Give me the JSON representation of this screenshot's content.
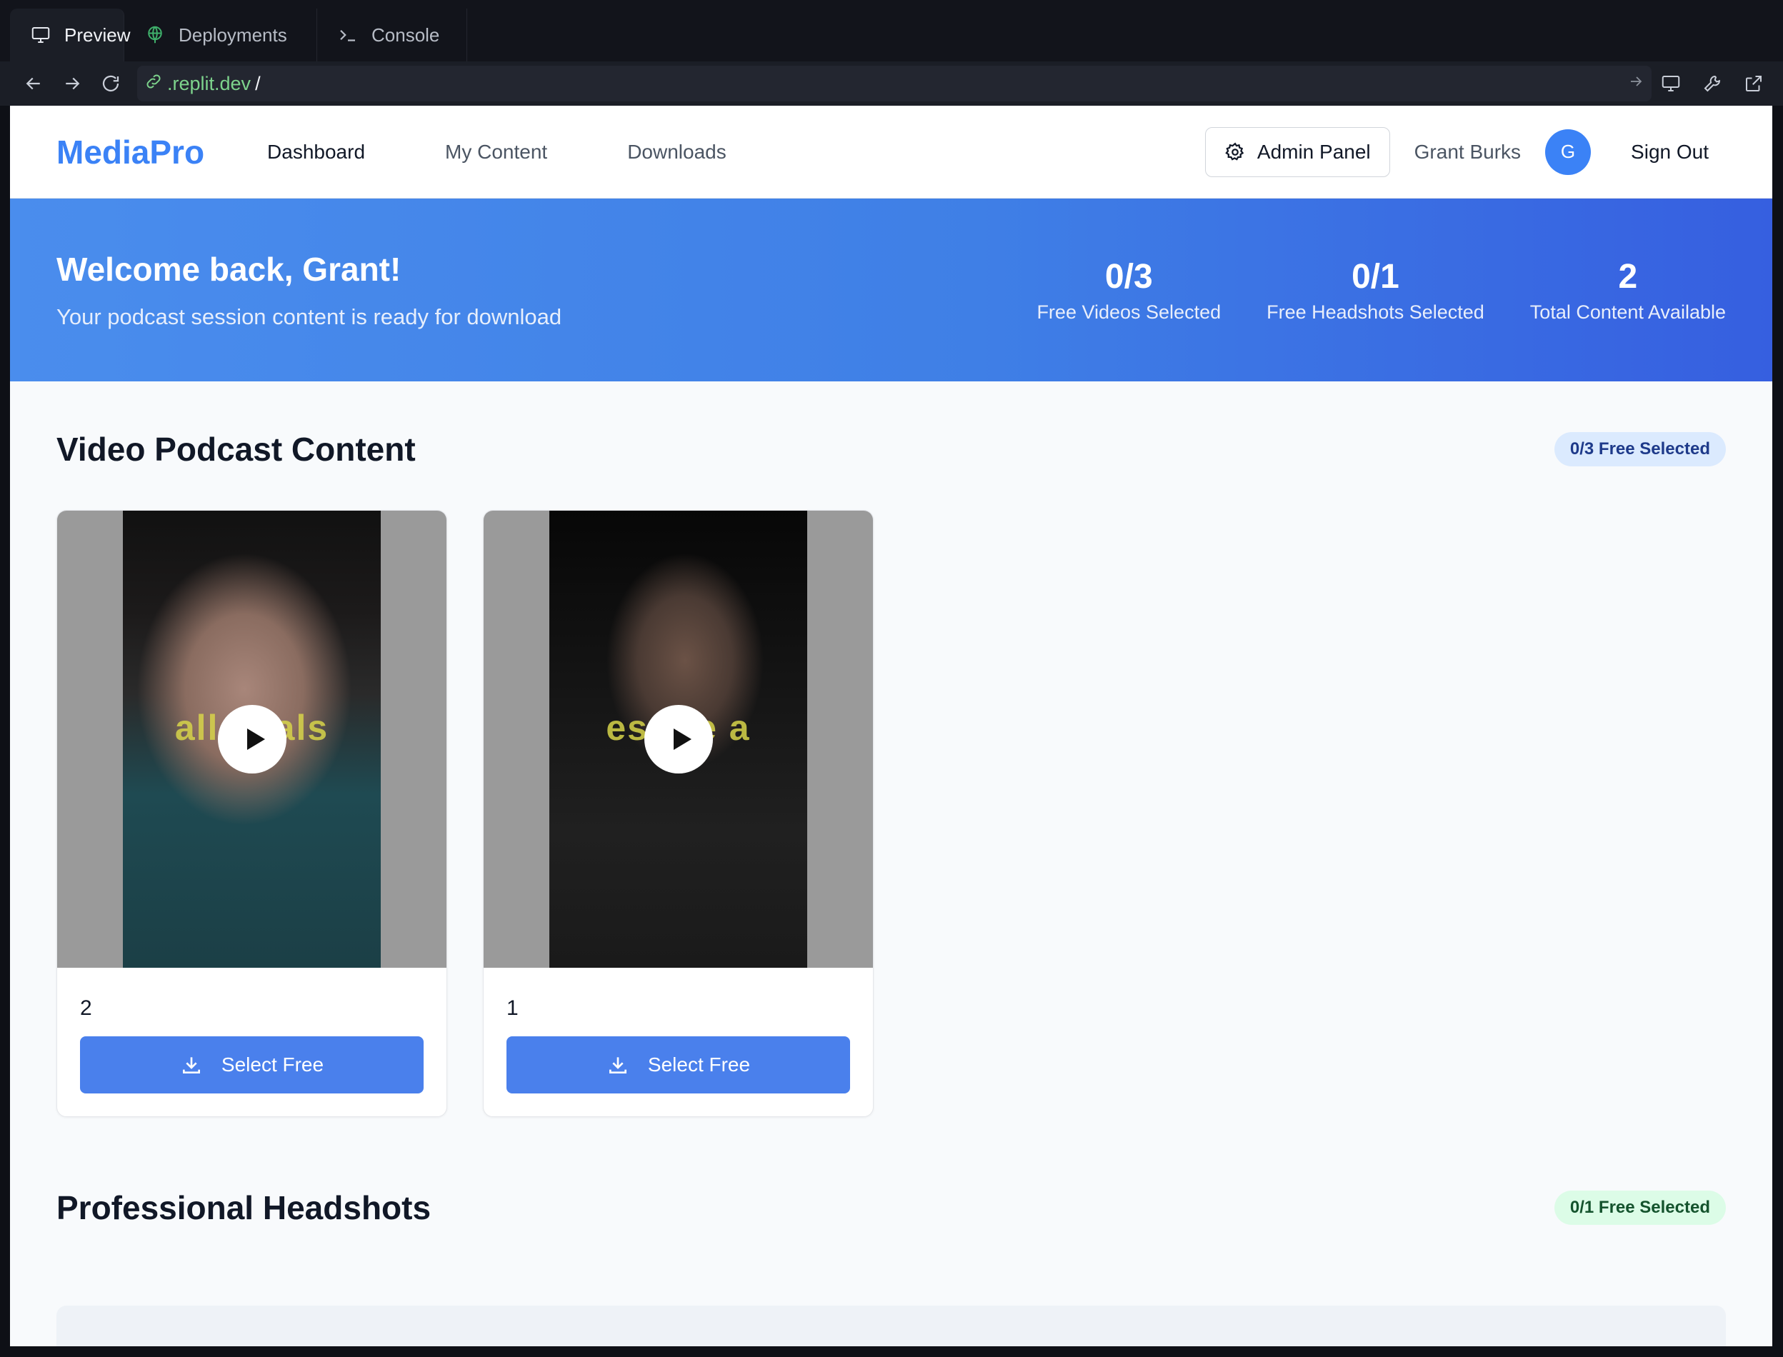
{
  "ide": {
    "tabs": [
      {
        "label": "Preview",
        "icon": "monitor-icon"
      },
      {
        "label": "Deployments",
        "icon": "globe-icon"
      },
      {
        "label": "Console",
        "icon": "terminal-icon"
      }
    ],
    "url": {
      "host": ".replit.dev",
      "path": "/"
    }
  },
  "app": {
    "brand": "MediaPro",
    "nav": [
      "Dashboard",
      "My Content",
      "Downloads"
    ],
    "admin_label": "Admin Panel",
    "user_name": "Grant Burks",
    "avatar_initial": "G",
    "signout": "Sign Out"
  },
  "hero": {
    "title": "Welcome back, Grant!",
    "subtitle": "Your podcast session content is ready for download",
    "stats": [
      {
        "value": "0/3",
        "label": "Free Videos Selected"
      },
      {
        "value": "0/1",
        "label": "Free Headshots Selected"
      },
      {
        "value": "2",
        "label": "Total Content Available"
      }
    ]
  },
  "videos": {
    "title": "Video Podcast Content",
    "badge": "0/3 Free Selected",
    "items": [
      {
        "title": "2",
        "caption": "all deals",
        "button": "Select Free"
      },
      {
        "title": "1",
        "caption": "estate a",
        "button": "Select Free"
      }
    ]
  },
  "headshots": {
    "title": "Professional Headshots",
    "badge": "0/1 Free Selected"
  },
  "colors": {
    "brand": "#3b82f6",
    "hero_start": "#4a8ded",
    "hero_end": "#365fe0",
    "button": "#4a80ec"
  }
}
